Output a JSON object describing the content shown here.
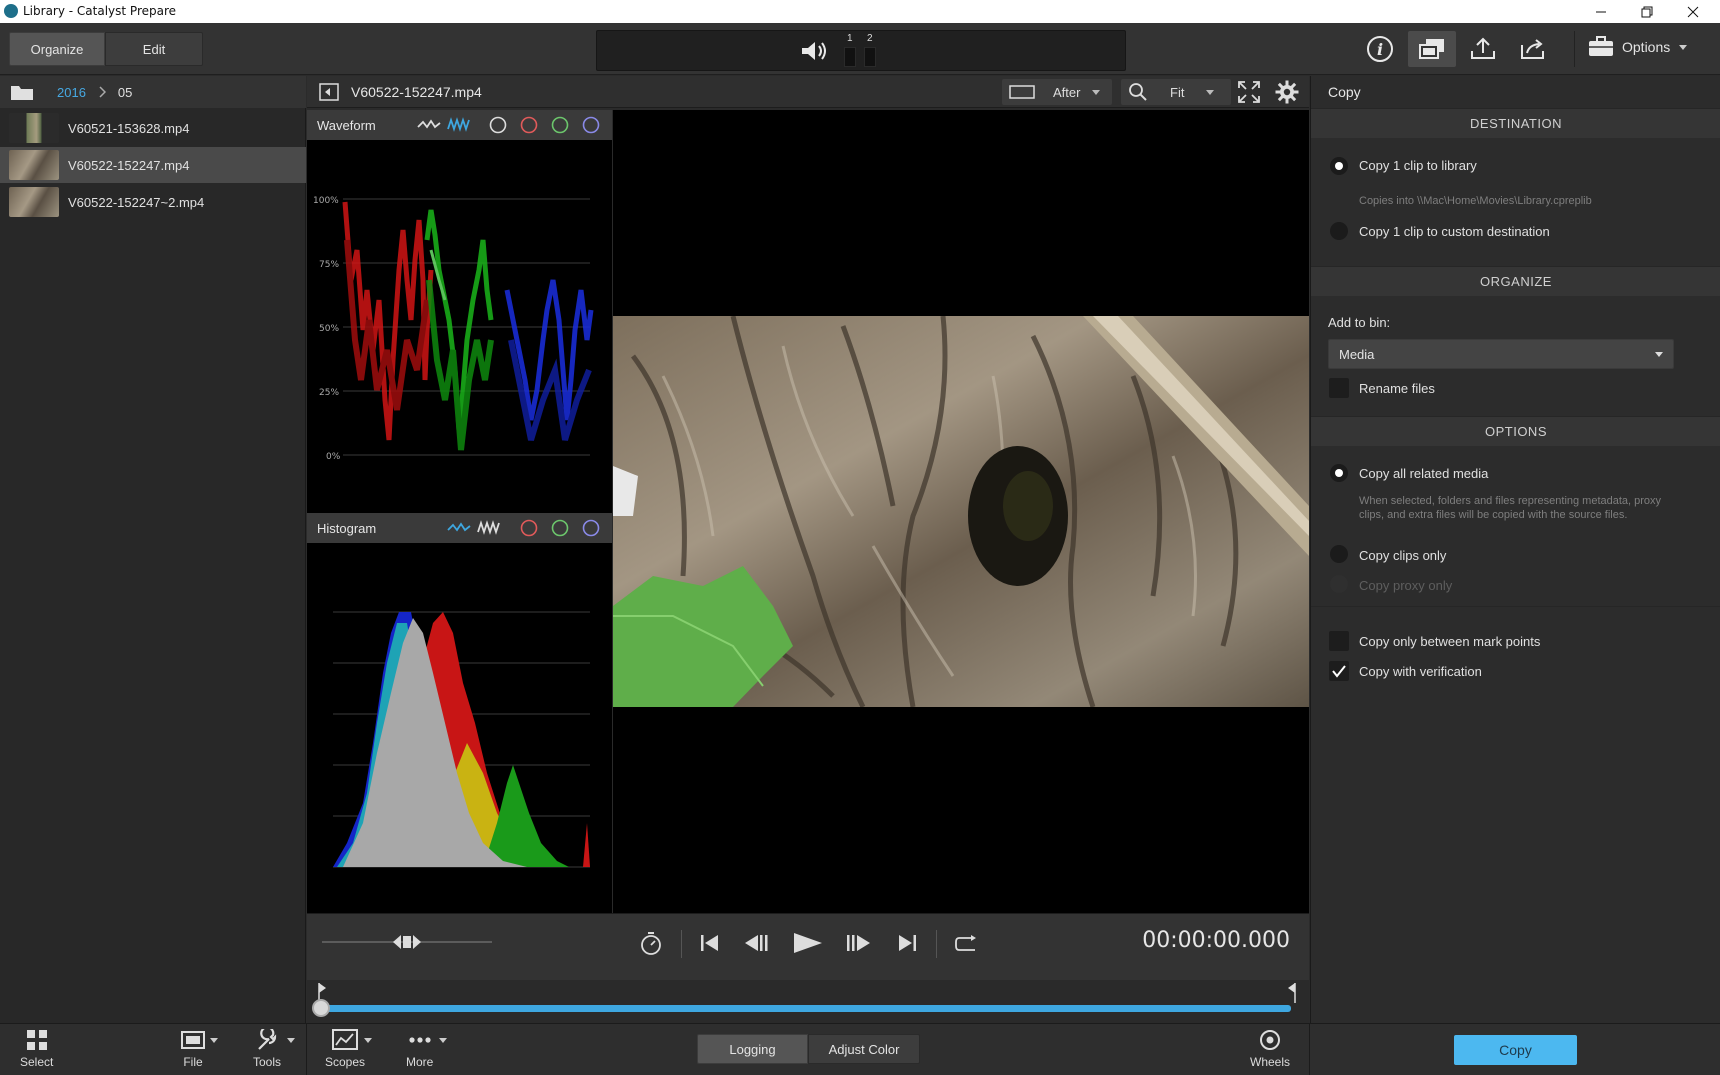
{
  "window": {
    "title": "Library - Catalyst Prepare"
  },
  "toolbar": {
    "modes": [
      {
        "label": "Organize",
        "active": true
      },
      {
        "label": "Edit",
        "active": false
      }
    ],
    "audio_channels": [
      "1",
      "2"
    ],
    "options_label": "Options"
  },
  "breadcrumb": {
    "year": "2016",
    "month": "05"
  },
  "clips": [
    {
      "name": "V60521-153628.mp4",
      "selected": false
    },
    {
      "name": "V60522-152247.mp4",
      "selected": true
    },
    {
      "name": "V60522-152247~2.mp4",
      "selected": false
    }
  ],
  "viewer": {
    "filename": "V60522-152247.mp4",
    "compare_mode": "After",
    "zoom": "Fit"
  },
  "waveform": {
    "title": "Waveform",
    "ticks": [
      "100%",
      "75%",
      "50%",
      "25%",
      "0%"
    ]
  },
  "histogram": {
    "title": "Histogram"
  },
  "transport": {
    "timecode": "00:00:00.000"
  },
  "copy_panel": {
    "title": "Copy",
    "destination": {
      "heading": "DESTINATION",
      "library_label": "Copy 1 clip to library",
      "library_hint": "Copies into \\\\Mac\\Home\\Movies\\Library.cpreplib",
      "custom_label": "Copy 1 clip to custom destination"
    },
    "organize": {
      "heading": "ORGANIZE",
      "bin_label": "Add to bin:",
      "bin_value": "Media",
      "rename_label": "Rename files"
    },
    "options": {
      "heading": "OPTIONS",
      "related_label": "Copy all related media",
      "related_hint": "When selected, folders and files representing metadata, proxy clips, and extra files will be copied with the source files.",
      "clips_only_label": "Copy clips only",
      "proxy_only_label": "Copy proxy only",
      "mark_points_label": "Copy only between mark points",
      "verification_label": "Copy with verification"
    },
    "copy_button": "Copy"
  },
  "bottom_bar": {
    "select": "Select",
    "file": "File",
    "tools": "Tools",
    "scopes": "Scopes",
    "more": "More",
    "logging": "Logging",
    "adjust_color": "Adjust Color",
    "wheels": "Wheels"
  },
  "colors": {
    "accent_blue": "#3ea7e0",
    "copy_button": "#4cb8f0"
  }
}
